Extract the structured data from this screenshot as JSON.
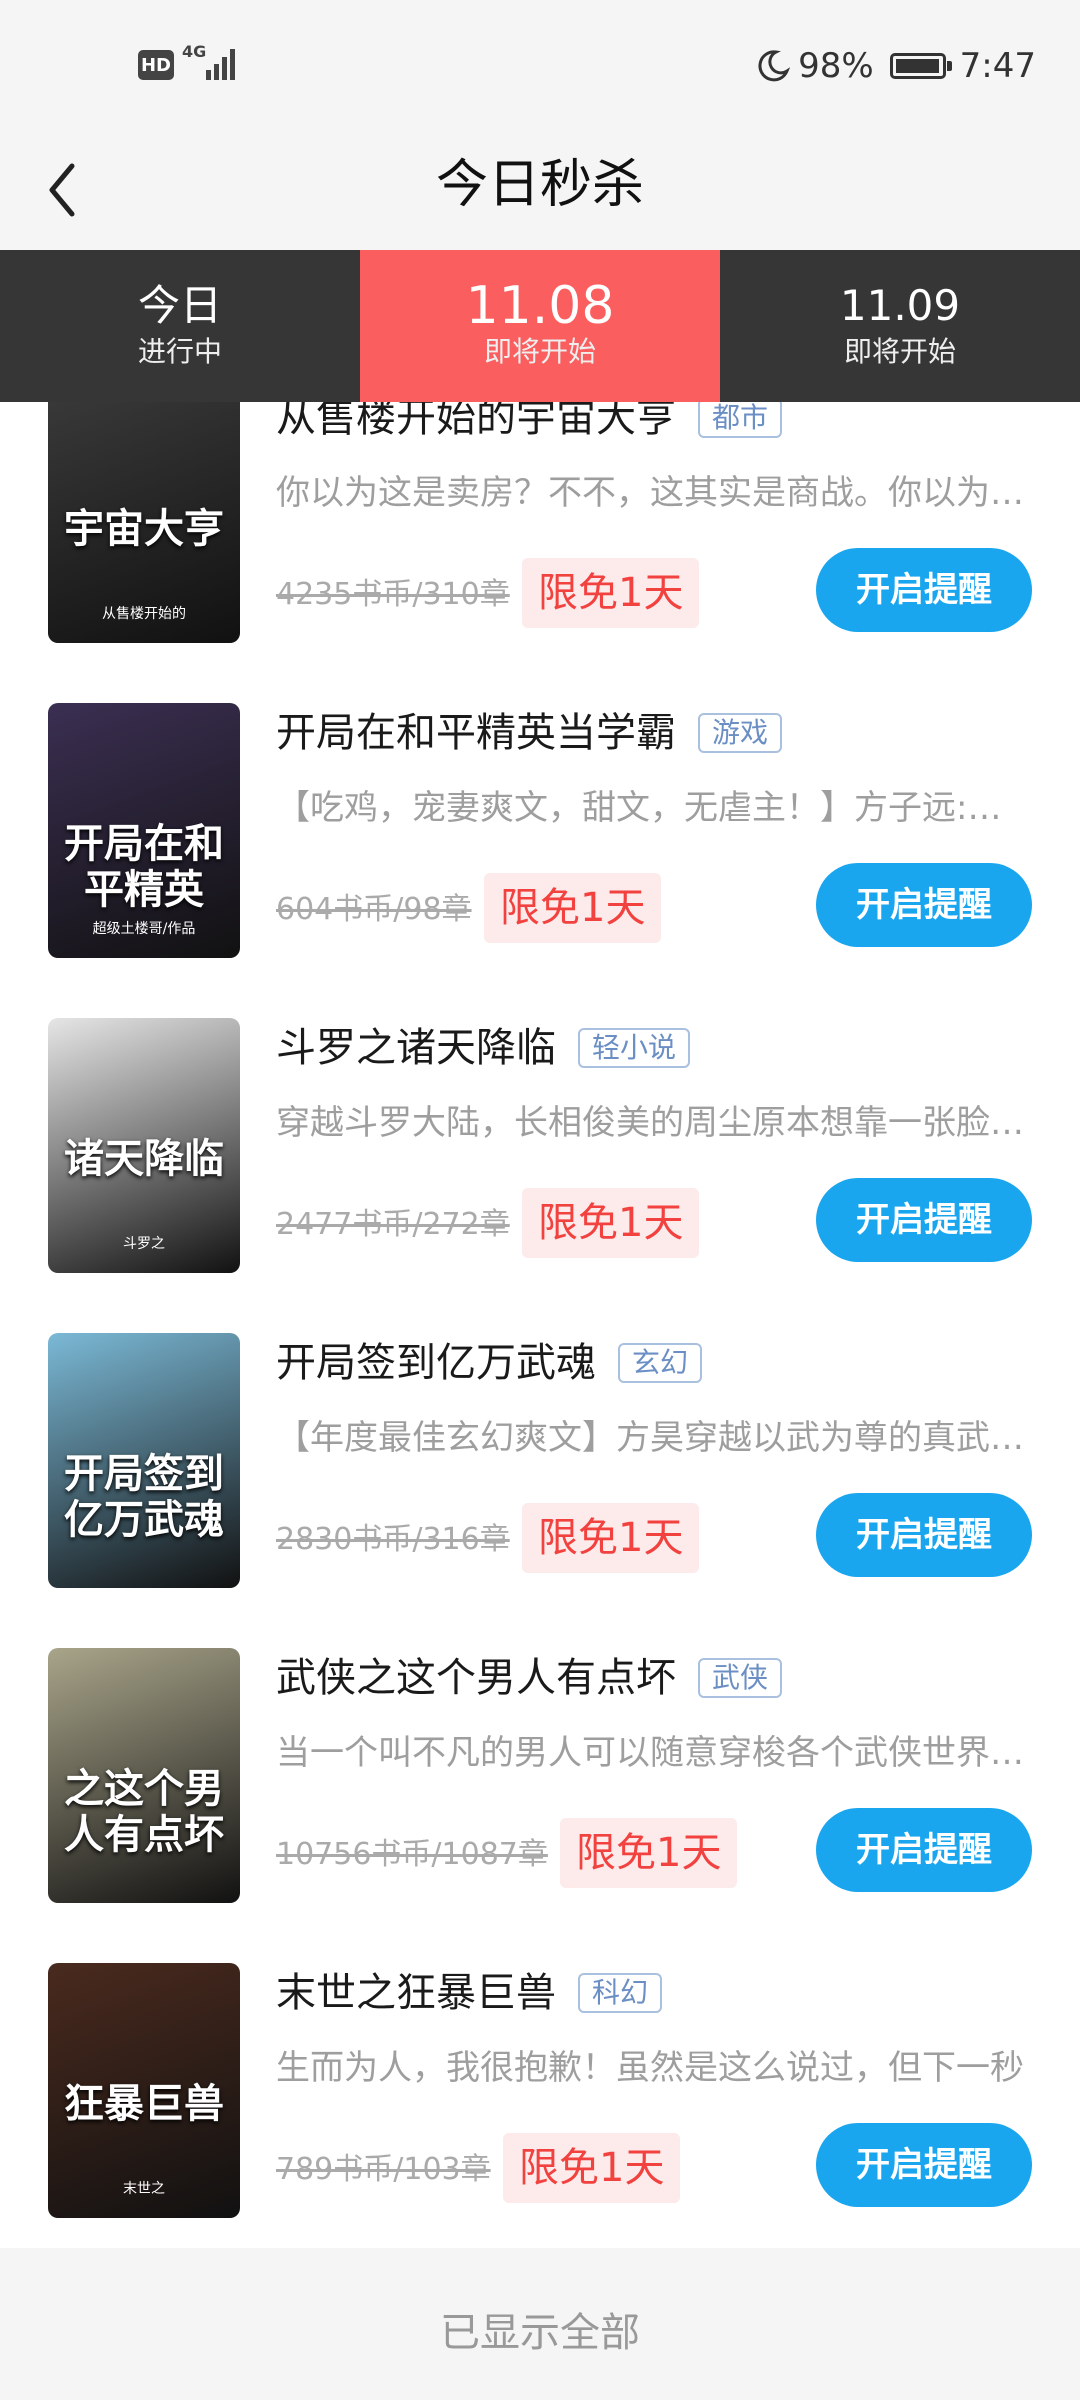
{
  "status_bar": {
    "hd": "HD",
    "network": "4G",
    "battery_percent": "98%",
    "battery_level": 0.98,
    "time": "7:47"
  },
  "header": {
    "title": "今日秒杀",
    "back_icon": "chevron-left-icon"
  },
  "tabs": [
    {
      "title": "今日",
      "subtitle": "进行中",
      "active": false
    },
    {
      "title": "11.08",
      "subtitle": "即将开始",
      "active": true
    },
    {
      "title": "11.09",
      "subtitle": "即将开始",
      "active": false
    }
  ],
  "books": [
    {
      "title": "从售楼开始的宇宙大亨",
      "tag": "都市",
      "desc": "你以为这是卖房？不不，这其实是商战。你以为这是商战？不不，这是宇宙",
      "price": "4235书币/310章",
      "badge": "限免1天",
      "button": "开启提醒",
      "cover_text": "宇宙大亨",
      "cover_small": "从售楼开始的",
      "cover_color": "#3a3a3a"
    },
    {
      "title": "开局在和平精英当学霸",
      "tag": "游戏",
      "desc": "【吃鸡，宠妻爽文，甜文，无虐主！】方子远:…",
      "price": "604书币/98章",
      "badge": "限免1天",
      "button": "开启提醒",
      "cover_text": "开局在和平精英",
      "cover_small": "超级土楼哥/作品",
      "cover_color": "#3b2f52"
    },
    {
      "title": "斗罗之诸天降临",
      "tag": "轻小说",
      "desc": "穿越斗罗大陆，长相俊美的周尘原本想靠一张脸混日子",
      "price": "2477书币/272章",
      "badge": "限免1天",
      "button": "开启提醒",
      "cover_text": "诸天降临",
      "cover_small": "斗罗之",
      "cover_color": "#e6e6e6"
    },
    {
      "title": "开局签到亿万武魂",
      "tag": "玄幻",
      "desc": "【年度最佳玄幻爽文】方昊穿越以武为尊的真武大陆",
      "price": "2830书币/316章",
      "badge": "限免1天",
      "button": "开启提醒",
      "cover_text": "开局签到亿万武魂",
      "cover_small": "",
      "cover_color": "#7bb9d6"
    },
    {
      "title": "武侠之这个男人有点坏",
      "tag": "武侠",
      "desc": "当一个叫不凡的男人可以随意穿梭各个武侠世界的时候",
      "price": "10756书币/1087章",
      "badge": "限免1天",
      "button": "开启提醒",
      "cover_text": "之这个男人有点坏",
      "cover_small": "",
      "cover_color": "#a9a58a"
    },
    {
      "title": "末世之狂暴巨兽",
      "tag": "科幻",
      "desc": "生而为人，我很抱歉！虽然是这么说过，但下一秒",
      "price": "789书币/103章",
      "badge": "限免1天",
      "button": "开启提醒",
      "cover_text": "狂暴巨兽",
      "cover_small": "末世之",
      "cover_color": "#4a2a1e"
    }
  ],
  "footer": {
    "text": "已显示全部"
  },
  "colors": {
    "accent_red": "#fb5e5e",
    "button_blue": "#1aa6ef",
    "tab_bg": "#363636",
    "badge_text": "#f1423f"
  }
}
